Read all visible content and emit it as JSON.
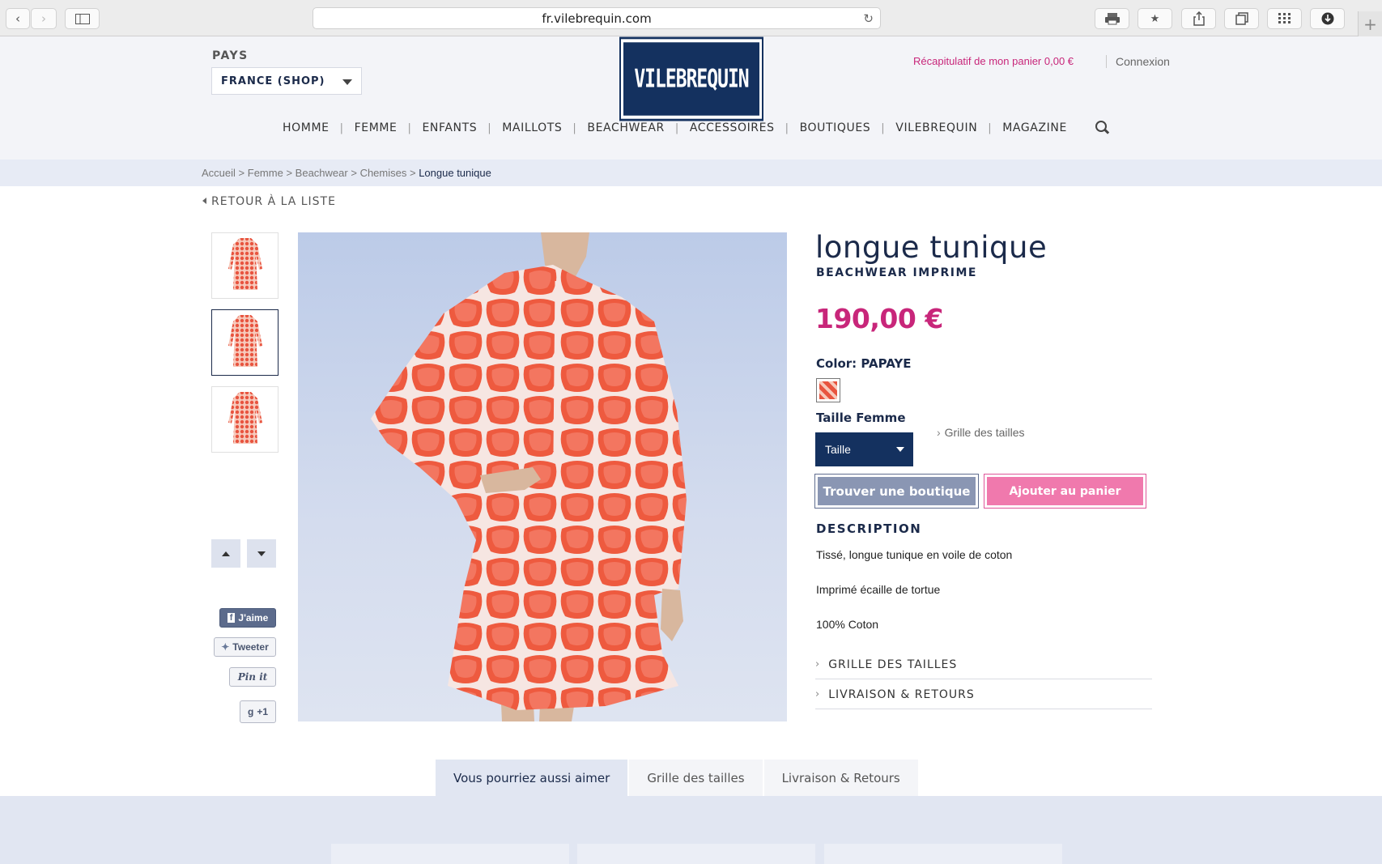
{
  "browser": {
    "url": "fr.vilebrequin.com",
    "back_icon": "chevron-left-icon",
    "forward_icon": "chevron-right-icon"
  },
  "header": {
    "pays_label": "PAYS",
    "country_value": "FRANCE (SHOP)",
    "logo_text": "VILEBREQUIN",
    "cart_summary": "Récapitulatif de mon panier 0,00 €",
    "login": "Connexion"
  },
  "nav": {
    "items": [
      "HOMME",
      "FEMME",
      "ENFANTS",
      "MAILLOTS",
      "BEACHWEAR",
      "ACCESSOIRES",
      "BOUTIQUES",
      "VILEBREQUIN",
      "MAGAZINE"
    ]
  },
  "breadcrumb": {
    "items": [
      "Accueil",
      "Femme",
      "Beachwear",
      "Chemises"
    ],
    "current": "Longue tunique",
    "separator": ">"
  },
  "back_link": "RETOUR À LA LISTE",
  "social": {
    "facebook": "J'aime",
    "twitter": "Tweeter",
    "pinterest": "Pin it",
    "gplus": "+1"
  },
  "product": {
    "title": "longue tunique",
    "subtitle": "BEACHWEAR IMPRIME",
    "price": "190,00 €",
    "color_label": "Color:",
    "color_value": "PAPAYE",
    "size_label": "Taille Femme",
    "size_select": "Taille",
    "size_chart_link": "Grille des tailles",
    "find_store": "Trouver une boutique",
    "add_to_cart": "Ajouter au panier",
    "description_title": "DESCRIPTION",
    "description": [
      "Tissé, longue tunique en voile de coton",
      "Imprimé écaille de tortue",
      "100% Coton"
    ],
    "accordion": [
      "GRILLE DES TAILLES",
      "LIVRAISON & RETOURS"
    ],
    "colors": {
      "print_red": "#e8543f",
      "print_light": "#f7c9bb",
      "accent": "#c8267a",
      "navy": "#14315f"
    }
  },
  "tabs": [
    "Vous pourriez aussi aimer",
    "Grille des tailles",
    "Livraison & Retours"
  ]
}
